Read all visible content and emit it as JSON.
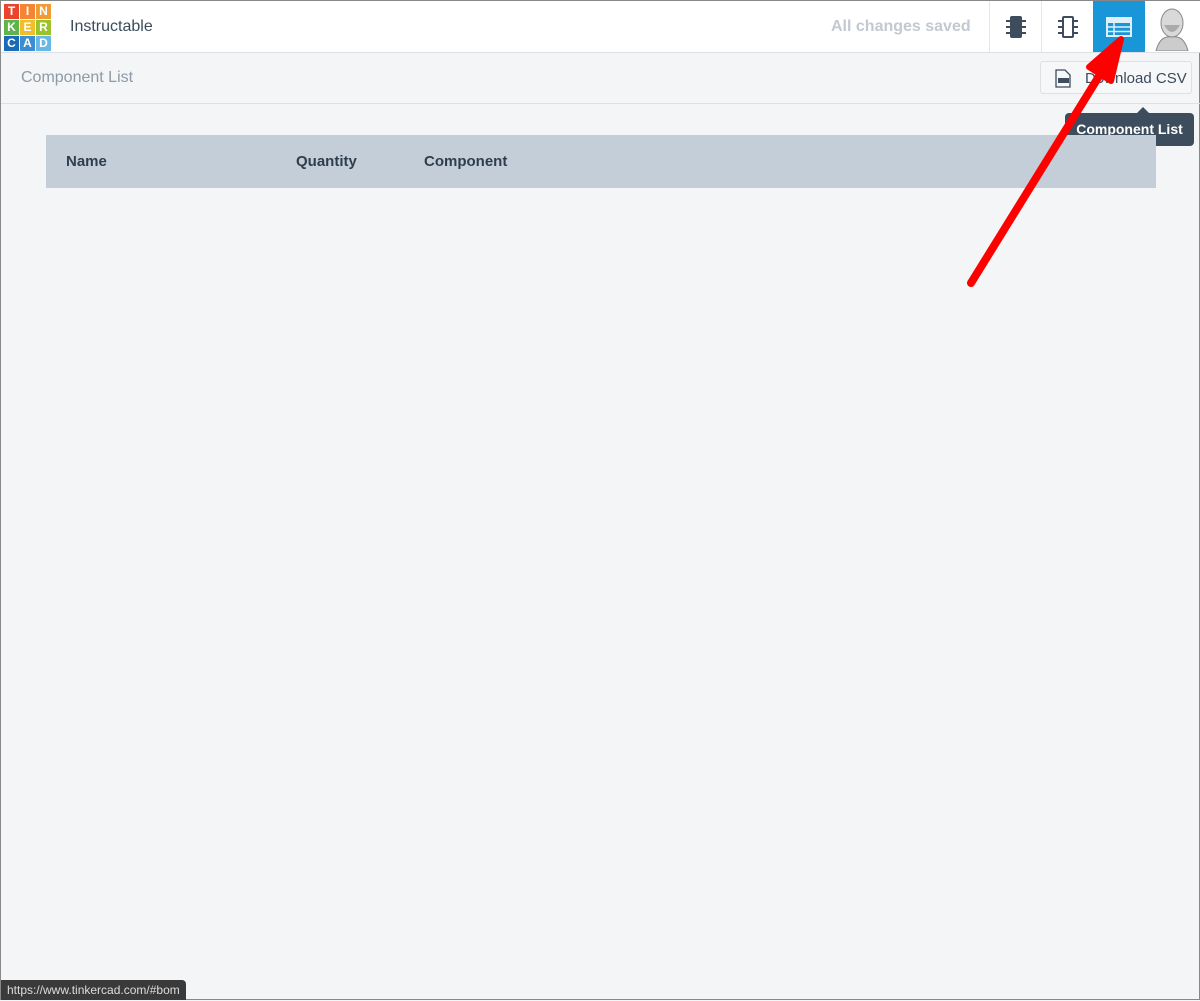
{
  "header": {
    "logo_letters": [
      "T",
      "I",
      "N",
      "K",
      "E",
      "R",
      "C",
      "A",
      "D"
    ],
    "logo_colors": [
      "#e8442e",
      "#f38535",
      "#f09b33",
      "#5eb44a",
      "#f0bd2b",
      "#9cc22a",
      "#1a6bb5",
      "#3b8fd1",
      "#69b7e4"
    ],
    "title": "Instructable",
    "save_status": "All changes saved",
    "accent": "#1996d8"
  },
  "toolbar": {
    "items": [
      {
        "icon": "breadboard-chip-icon"
      },
      {
        "icon": "schematic-chip-icon"
      },
      {
        "icon": "component-list-icon",
        "active": true
      },
      {
        "icon": "user-avatar"
      }
    ]
  },
  "subheader": {
    "title": "Component List",
    "download_label": "Download CSV"
  },
  "tooltip": "Component List",
  "table": {
    "columns": [
      "Name",
      "Quantity",
      "Component"
    ],
    "rows": []
  },
  "status_bar": "https://www.tinkercad.com/#bom",
  "annotation": {
    "color": "#ff0000"
  }
}
